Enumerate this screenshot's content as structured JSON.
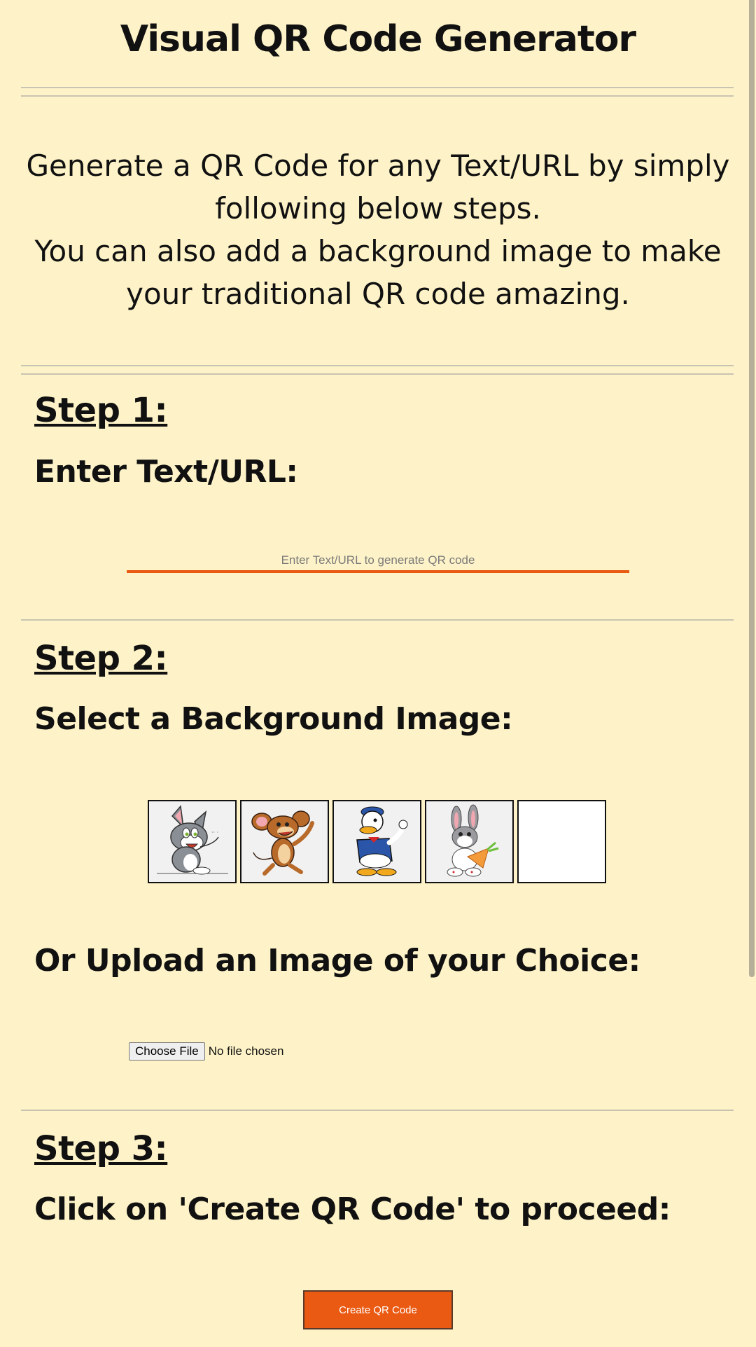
{
  "header": {
    "title": "Visual QR Code Generator"
  },
  "intro": {
    "line1": "Generate a QR Code for any Text/URL by simply following below steps.",
    "line2": "You can also add a background image to make your traditional QR code amazing."
  },
  "step1": {
    "heading": "Step 1:",
    "label": "Enter Text/URL:",
    "input_placeholder": "Enter Text/URL to generate QR code",
    "input_value": ""
  },
  "step2": {
    "heading": "Step 2:",
    "label": "Select a Background Image:",
    "images": [
      {
        "icon": "cat-cartoon-icon"
      },
      {
        "icon": "mouse-cartoon-icon"
      },
      {
        "icon": "duck-cartoon-icon"
      },
      {
        "icon": "bunny-cartoon-icon"
      },
      {
        "icon": "blank-image-icon"
      }
    ],
    "upload_label": "Or Upload an Image of your Choice:",
    "choose_file_label": "Choose File",
    "file_status": "No file chosen"
  },
  "step3": {
    "heading": "Step 3:",
    "label": "Click on 'Create QR Code' to proceed:",
    "button_label": "Create QR Code"
  },
  "colors": {
    "background": "#fef3c8",
    "accent": "#ea5a13",
    "divider": "#c9c4b2"
  }
}
